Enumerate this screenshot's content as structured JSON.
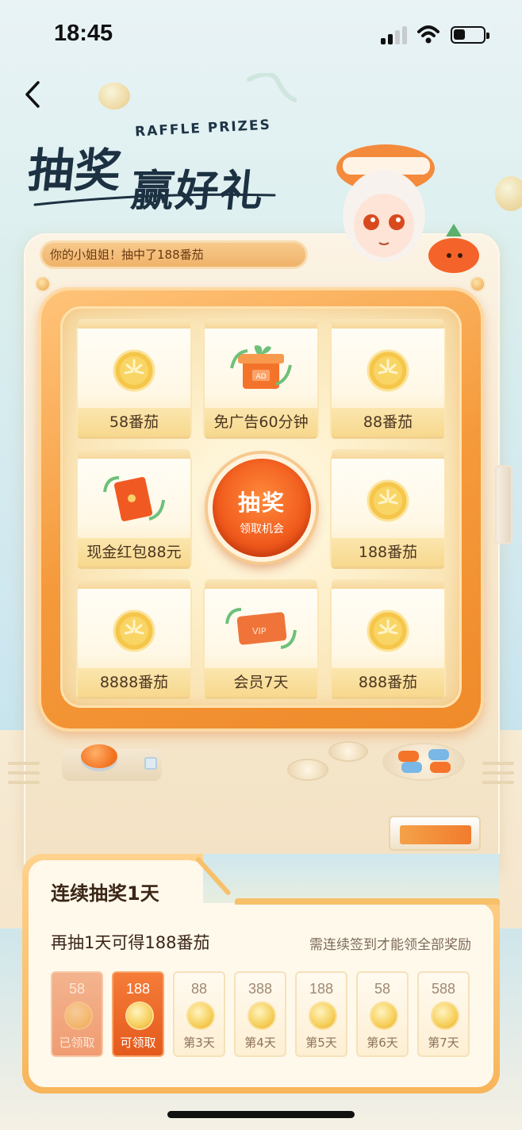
{
  "status_bar": {
    "time": "18:45"
  },
  "header": {
    "headline_en": "RAFFLE  PRIZES",
    "headline_line1": "抽奖",
    "headline_line2": "赢好礼"
  },
  "notice": {
    "text": "你的小姐姐！抽中了188番茄"
  },
  "prizes": [
    {
      "label": "58番茄",
      "icon": "coin-icon"
    },
    {
      "label": "免广告60分钟",
      "icon": "ad-gift-icon"
    },
    {
      "label": "88番茄",
      "icon": "coin-icon"
    },
    {
      "label": "现金红包88元",
      "icon": "red-envelope-icon"
    },
    {
      "label": "188番茄",
      "icon": "coin-icon"
    },
    {
      "label": "8888番茄",
      "icon": "coin-icon"
    },
    {
      "label": "会员7天",
      "icon": "vip-card-icon"
    },
    {
      "label": "888番茄",
      "icon": "coin-icon"
    }
  ],
  "draw_button": {
    "title": "抽奖",
    "subtitle": "领取机会"
  },
  "streak_panel": {
    "title": "连续抽奖1天",
    "subtitle": "再抽1天可得188番茄",
    "note": "需连续签到才能领全部奖励",
    "days": [
      {
        "amount": "58",
        "label": "已领取",
        "state": "claimed"
      },
      {
        "amount": "188",
        "label": "可领取",
        "state": "available"
      },
      {
        "amount": "88",
        "label": "第3天",
        "state": "locked"
      },
      {
        "amount": "388",
        "label": "第4天",
        "state": "locked"
      },
      {
        "amount": "188",
        "label": "第5天",
        "state": "locked"
      },
      {
        "amount": "58",
        "label": "第6天",
        "state": "locked"
      },
      {
        "amount": "588",
        "label": "第7天",
        "state": "locked"
      }
    ]
  },
  "colors": {
    "accent": "#f05a1c",
    "frame": "#f59a3c",
    "headline": "#1c3142"
  }
}
